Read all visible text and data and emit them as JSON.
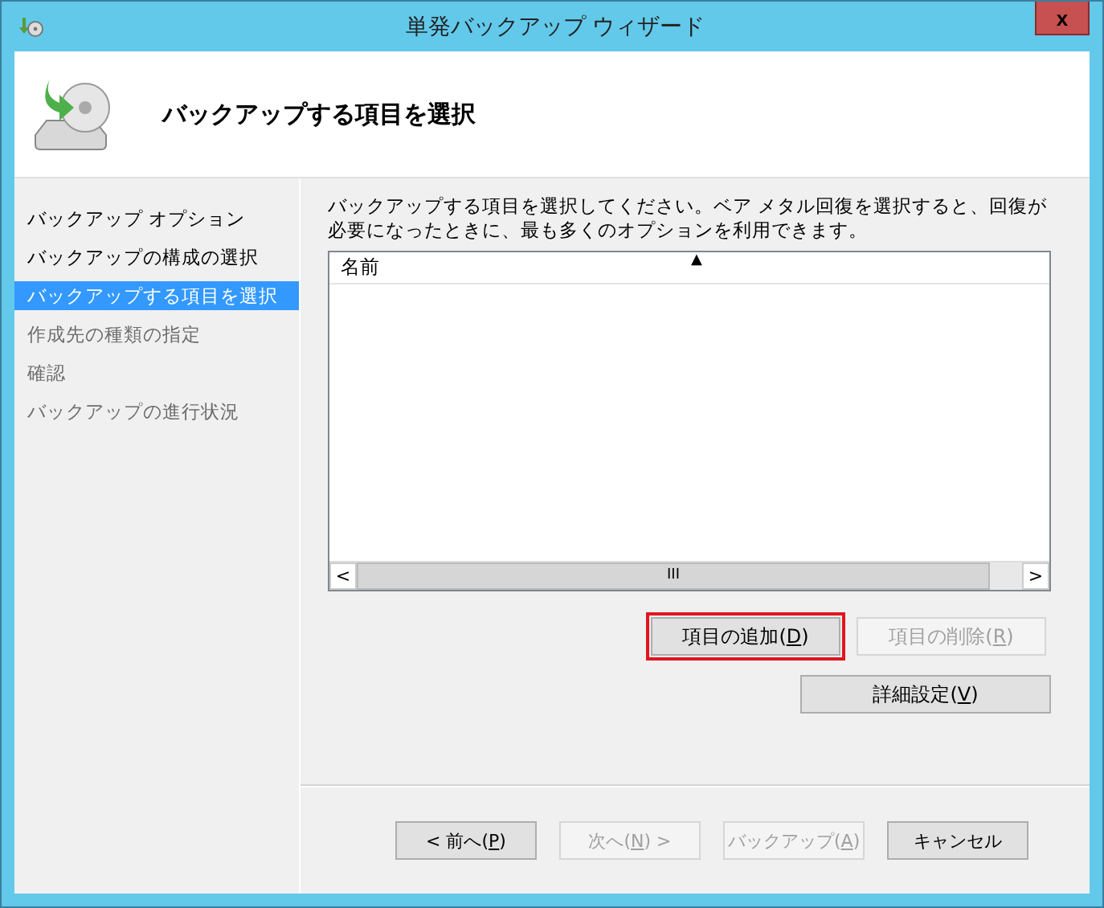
{
  "window": {
    "title": "単発バックアップ ウィザード",
    "close": "x"
  },
  "header": {
    "title": "バックアップする項目を選択"
  },
  "sidebar": {
    "items": [
      {
        "label": "バックアップ オプション",
        "selected": false,
        "disabled": false
      },
      {
        "label": "バックアップの構成の選択",
        "selected": false,
        "disabled": false
      },
      {
        "label": "バックアップする項目を選択",
        "selected": true,
        "disabled": false
      },
      {
        "label": "作成先の種類の指定",
        "selected": false,
        "disabled": true
      },
      {
        "label": "確認",
        "selected": false,
        "disabled": true
      },
      {
        "label": "バックアップの進行状況",
        "selected": false,
        "disabled": true
      }
    ]
  },
  "description": "バックアップする項目を選択してください。ベア メタル回復を選択すると、回復が必要になったときに、最も多くのオプションを利用できます。",
  "list": {
    "columns": [
      "名前"
    ],
    "sort_arrow": "▲",
    "scroll_left": "<",
    "scroll_thumb": "III",
    "scroll_right": ">"
  },
  "item_buttons": [
    {
      "text": "項目の追加(",
      "key": "D",
      "rest": ")",
      "disabled": false,
      "highlighted": true
    },
    {
      "text": "項目の削除(",
      "key": "R",
      "rest": ")",
      "disabled": true,
      "highlighted": false
    }
  ],
  "advanced_button": {
    "text": "詳細設定(",
    "key": "V",
    "rest": ")",
    "disabled": false
  },
  "footer_buttons": [
    {
      "text": "< 前へ(",
      "key": "P",
      "rest": ")",
      "disabled": false
    },
    {
      "text": "次へ(",
      "key": "N",
      "rest": ") >",
      "disabled": true
    },
    {
      "text": "バックアップ(",
      "key": "A",
      "rest": ")",
      "disabled": true
    },
    {
      "text": "キャンセル",
      "disabled": false
    }
  ]
}
